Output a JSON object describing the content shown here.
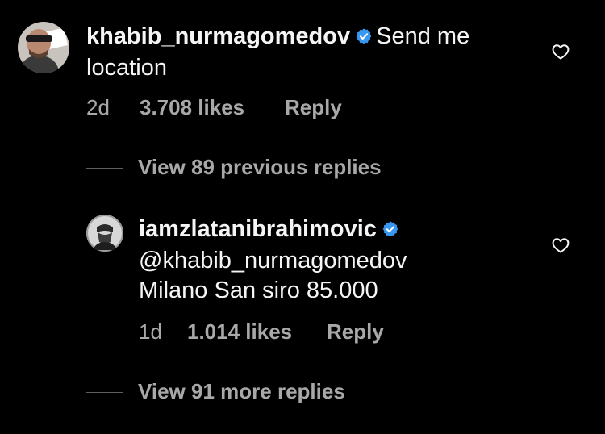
{
  "comments": [
    {
      "username": "khabib_nurmagomedov",
      "verified": true,
      "text": "Send me location",
      "text_line1": "Send me",
      "text_line2": "location",
      "time": "2d",
      "likes": "3.708 likes",
      "reply_label": "Reply"
    },
    {
      "username": "iamzlatanibrahimovic",
      "verified": true,
      "mention": "@khabib_nurmagomedov",
      "text": "Milano San siro 85.000",
      "time": "1d",
      "likes": "1.014 likes",
      "reply_label": "Reply"
    }
  ],
  "view_previous_replies": "View 89 previous replies",
  "view_more_replies": "View 91 more replies",
  "colors": {
    "background": "#000000",
    "text": "#f5f5f5",
    "secondary_text": "#a8a8a8",
    "verified_badge": "#3897f0"
  },
  "icons": {
    "like": "heart-outline-icon",
    "verified": "verified-badge-icon"
  }
}
